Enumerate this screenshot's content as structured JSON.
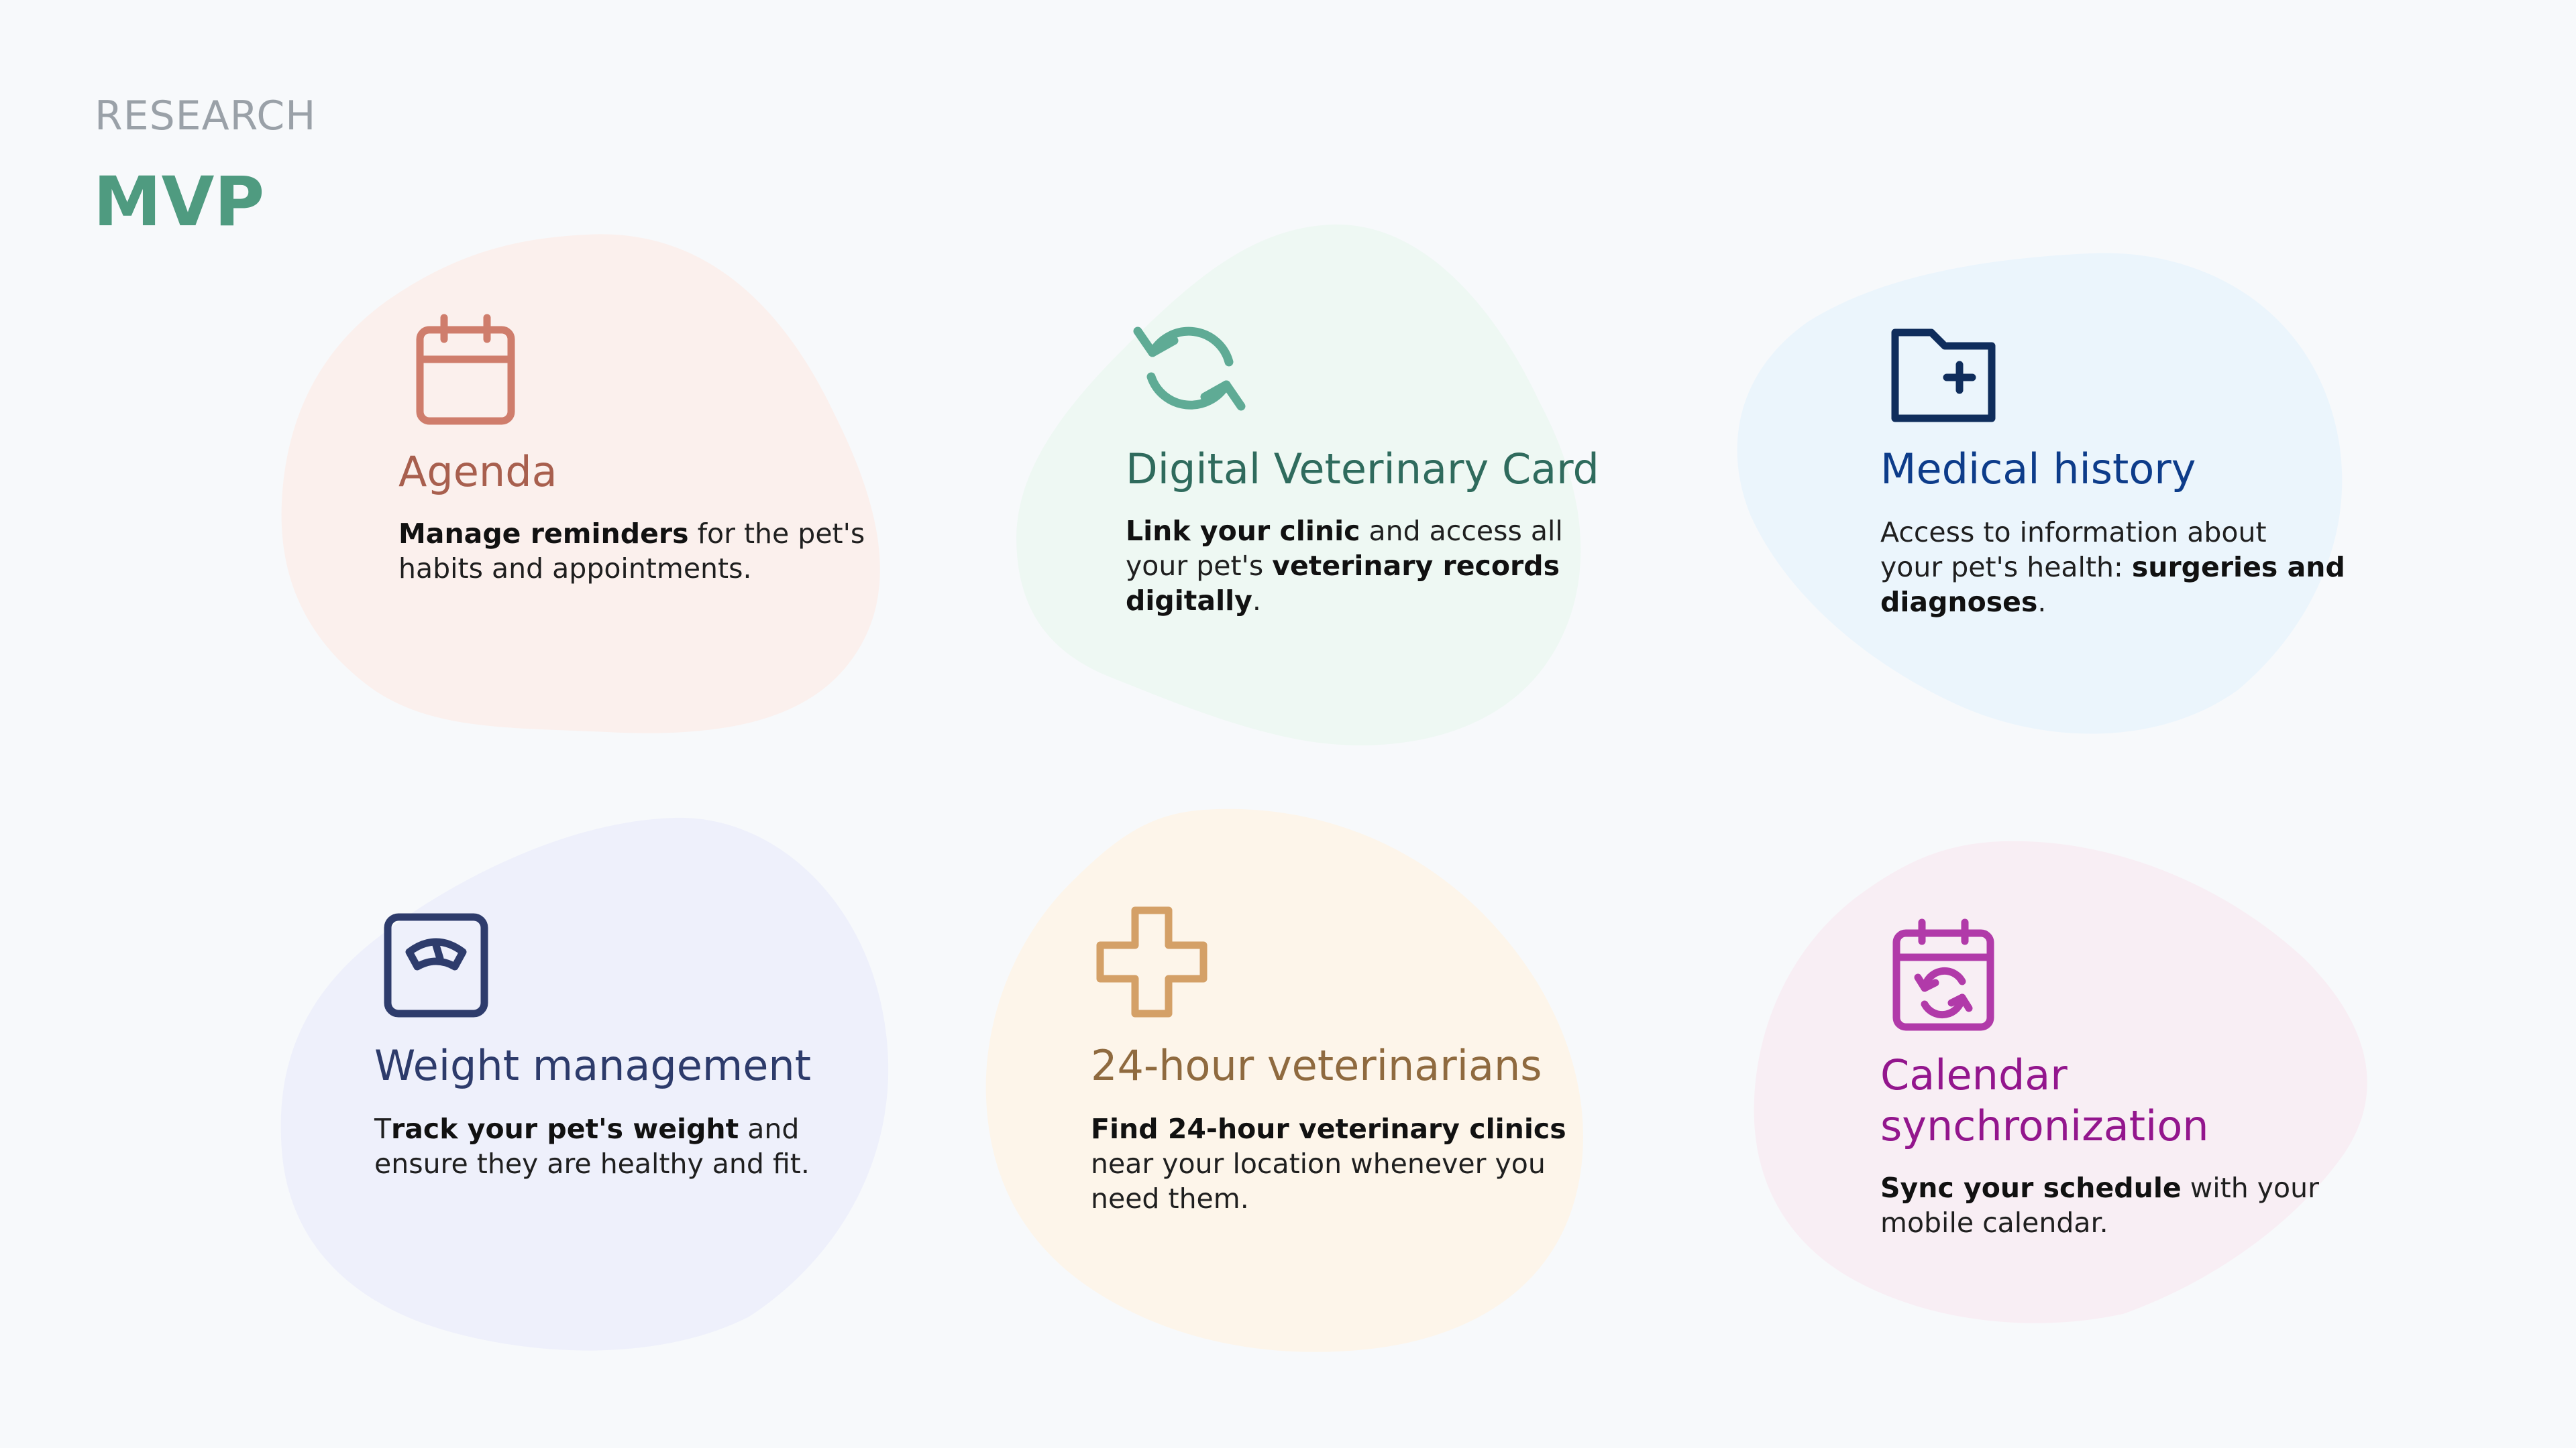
{
  "header": {
    "eyebrow": "RESEARCH",
    "title": "MVP"
  },
  "colors": {
    "background": "#f7f9fb",
    "eyebrow": "#9aa1a8",
    "title": "#4f9b80"
  },
  "cards": [
    {
      "id": "agenda",
      "icon": "calendar-icon",
      "title": "Agenda",
      "title_color": "#a85f4e",
      "icon_color": "#cf7d6c",
      "blob_color": "#fbf0ed",
      "desc": {
        "line1_bold": "Manage reminders",
        "line1_rest": " for the pet's",
        "line2": "habits and appointments."
      }
    },
    {
      "id": "digital-veterinary-card",
      "icon": "sync-arrows-icon",
      "title": "Digital Veterinary Card",
      "title_color": "#2f6b5d",
      "icon_color": "#5fab95",
      "blob_color": "#eef8f3",
      "desc": {
        "line1_bold": "Link your clinic",
        "line1_rest": " and access all",
        "line2_pre": "your pet's ",
        "line2_bold": "veterinary records",
        "line3_bold": "digitally",
        "line3_rest": "."
      }
    },
    {
      "id": "medical-history",
      "icon": "medical-folder-icon",
      "title": "Medical history",
      "title_color": "#0d3c8a",
      "icon_color": "#0f2d5c",
      "blob_color": "#ebf5fc",
      "desc": {
        "line1": "Access to information about",
        "line2_pre": "your pet's health: ",
        "line2_bold": "surgeries and",
        "line3_bold": "diagnoses",
        "line3_rest": "."
      }
    },
    {
      "id": "weight-management",
      "icon": "scale-icon",
      "title": "Weight management",
      "title_color": "#2d3b6b",
      "icon_color": "#2e3c6c",
      "blob_color": "#eef0fb",
      "desc": {
        "line1_pre": "T",
        "line1_bold": "rack your pet's weight",
        "line1_rest": " and",
        "line2": "ensure they are healthy and fit."
      }
    },
    {
      "id": "24-hour-veterinarians",
      "icon": "medical-cross-icon",
      "title": "24-hour veterinarians",
      "title_color": "#8f6a3f",
      "icon_color": "#d4a067",
      "blob_color": "#fdf5ea",
      "desc": {
        "line1_bold": "Find 24-hour veterinary clinics",
        "line2": "near your location whenever you",
        "line3": "need them."
      }
    },
    {
      "id": "calendar-synchronization",
      "icon": "calendar-sync-icon",
      "title_line1": "Calendar",
      "title_line2": "synchronization",
      "title_color": "#93168d",
      "icon_color": "#b13aa9",
      "blob_color": "#f8eef4",
      "desc": {
        "line1_bold": "Sync your schedule",
        "line1_rest": " with your",
        "line2": "mobile calendar."
      }
    }
  ]
}
